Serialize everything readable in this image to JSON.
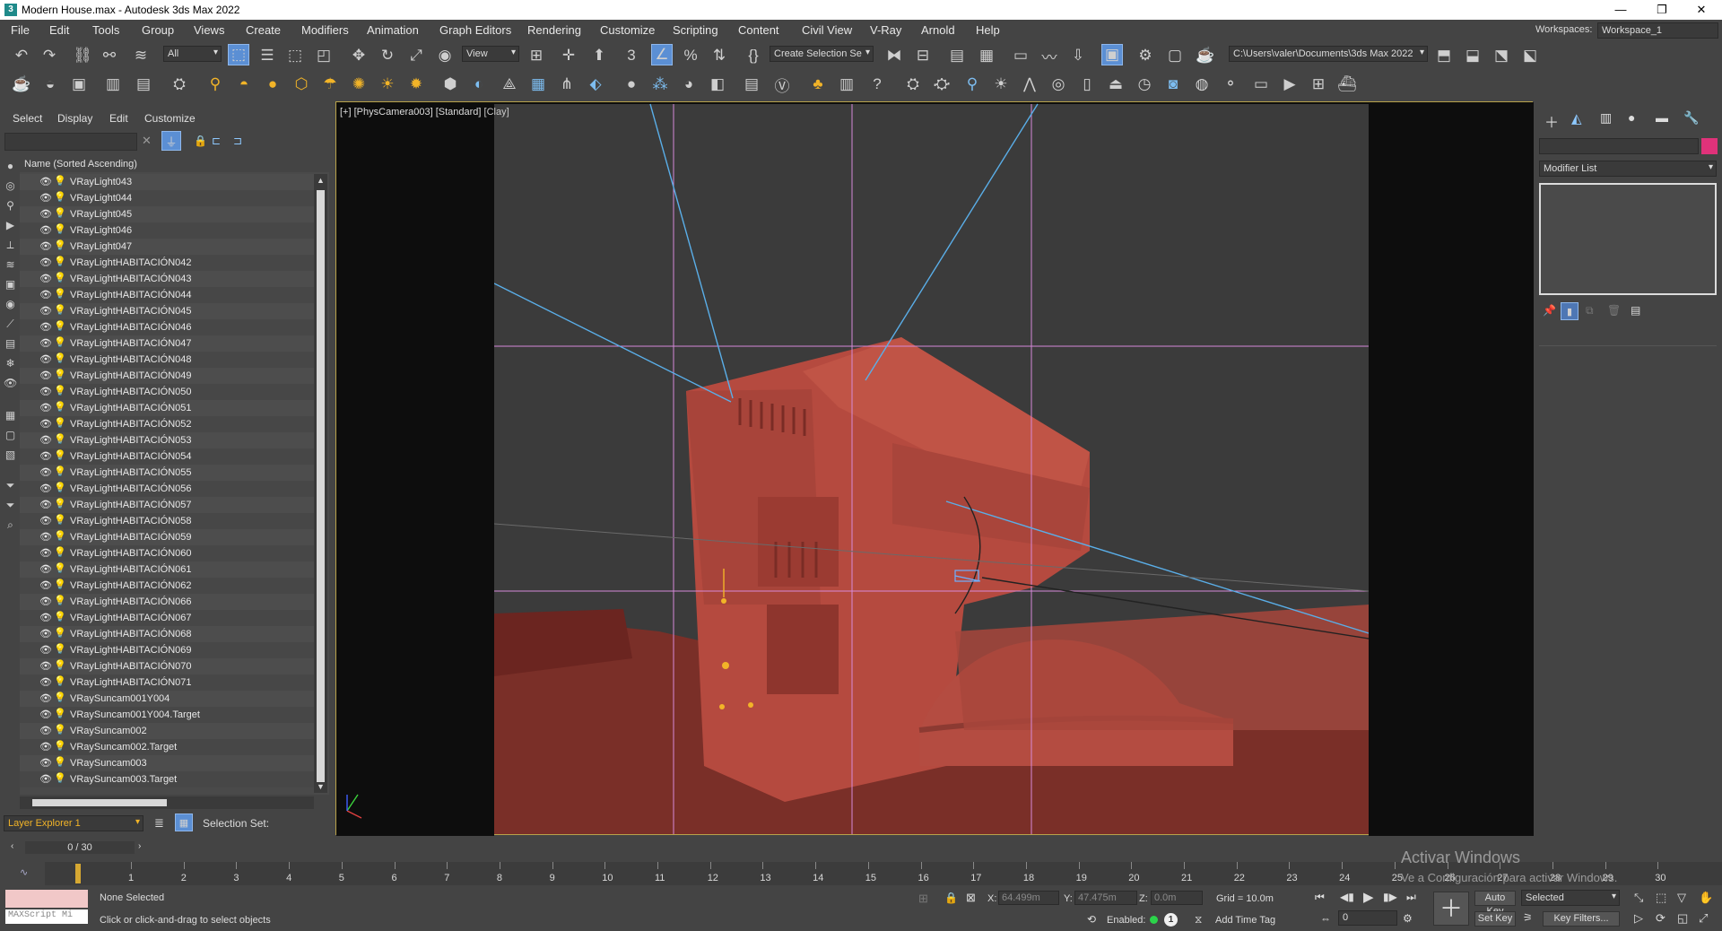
{
  "window": {
    "title": "Modern House.max - Autodesk 3ds Max 2022",
    "app_icon": "3ds-max-icon",
    "minimize": "—",
    "restore": "❐",
    "close": "✕"
  },
  "menu": [
    "File",
    "Edit",
    "Tools",
    "Group",
    "Views",
    "Create",
    "Modifiers",
    "Animation",
    "Graph Editors",
    "Rendering",
    "Customize",
    "Scripting",
    "Content",
    "Civil View",
    "V-Ray",
    "Arnold",
    "Help"
  ],
  "workspace": {
    "label": "Workspaces:",
    "value": "Workspace_1"
  },
  "toolbar1": {
    "filter_value": "All",
    "refcoord_value": "View",
    "selection_set_value": "Create Selection Se",
    "project_path": "C:\\Users\\valer\\Documents\\3ds Max 2022"
  },
  "scene_explorer": {
    "tabs": [
      "Select",
      "Display",
      "Edit",
      "Customize"
    ],
    "column_header": "Name (Sorted Ascending)",
    "items": [
      "VRayLight043",
      "VRayLight044",
      "VRayLight045",
      "VRayLight046",
      "VRayLight047",
      "VRayLightHABITACIÓN042",
      "VRayLightHABITACIÓN043",
      "VRayLightHABITACIÓN044",
      "VRayLightHABITACIÓN045",
      "VRayLightHABITACIÓN046",
      "VRayLightHABITACIÓN047",
      "VRayLightHABITACIÓN048",
      "VRayLightHABITACIÓN049",
      "VRayLightHABITACIÓN050",
      "VRayLightHABITACIÓN051",
      "VRayLightHABITACIÓN052",
      "VRayLightHABITACIÓN053",
      "VRayLightHABITACIÓN054",
      "VRayLightHABITACIÓN055",
      "VRayLightHABITACIÓN056",
      "VRayLightHABITACIÓN057",
      "VRayLightHABITACIÓN058",
      "VRayLightHABITACIÓN059",
      "VRayLightHABITACIÓN060",
      "VRayLightHABITACIÓN061",
      "VRayLightHABITACIÓN062",
      "VRayLightHABITACIÓN066",
      "VRayLightHABITACIÓN067",
      "VRayLightHABITACIÓN068",
      "VRayLightHABITACIÓN069",
      "VRayLightHABITACIÓN070",
      "VRayLightHABITACIÓN071",
      "VRaySuncam001Y004",
      "VRaySuncam001Y004.Target",
      "VRaySuncam002",
      "VRaySuncam002.Target",
      "VRaySuncam003",
      "VRaySuncam003.Target"
    ],
    "layer_explorer": "Layer Explorer 1",
    "selection_set_label": "Selection Set:"
  },
  "viewport": {
    "label_plus": "[+]",
    "label_camera": "[PhysCamera003]",
    "label_standard": "[Standard]",
    "label_shading": "[Clay]"
  },
  "command_panel": {
    "modifier_list": "Modifier List"
  },
  "timeline": {
    "slider": "0 / 30",
    "ticks": [
      "1",
      "2",
      "3",
      "4",
      "5",
      "6",
      "7",
      "8",
      "9",
      "10",
      "11",
      "12",
      "13",
      "14",
      "15",
      "16",
      "17",
      "18",
      "19",
      "20",
      "21",
      "22",
      "23",
      "24",
      "25",
      "26",
      "27",
      "28",
      "29",
      "30"
    ]
  },
  "status": {
    "maxscript_placeholder": "MAXScript Mi",
    "selection": "None Selected",
    "prompt": "Click or click-and-drag to select objects",
    "x_label": "X:",
    "x_value": "64.499m",
    "y_label": "Y:",
    "y_value": "47.475m",
    "z_label": "Z:",
    "z_value": "0.0m",
    "grid": "Grid = 10.0m",
    "enabled": "Enabled:",
    "add_time_tag": "Add Time Tag",
    "auto_key": "Auto Key",
    "key_mode": "Selected",
    "set_key": "Set Key",
    "key_filters": "Key Filters...",
    "frame": "0"
  },
  "watermark": {
    "line1": "Activar Windows",
    "line2": "Ve a Configuración para activar Windows."
  }
}
